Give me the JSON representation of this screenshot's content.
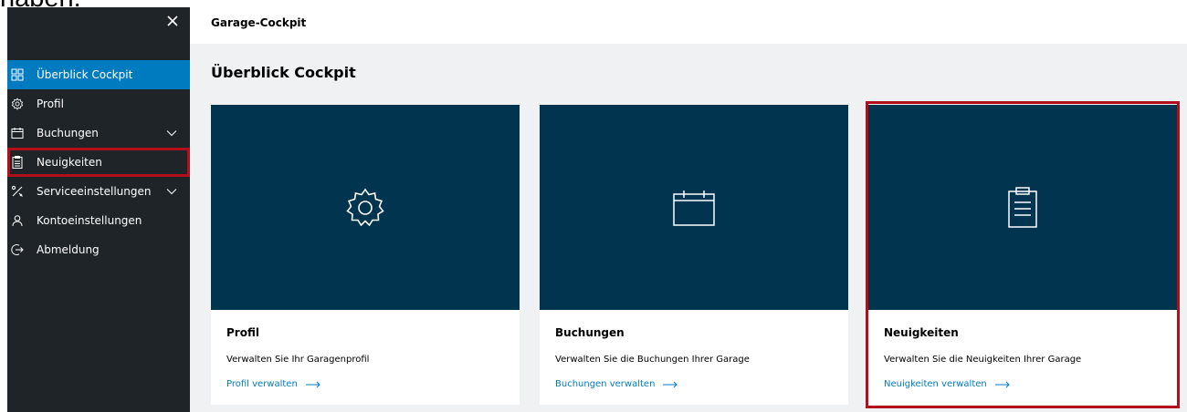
{
  "caption": "haben.",
  "sidebar": {
    "items": [
      {
        "label": "Überblick Cockpit",
        "icon": "grid-icon",
        "active": true
      },
      {
        "label": "Profil",
        "icon": "gear-icon"
      },
      {
        "label": "Buchungen",
        "icon": "calendar-icon",
        "expandable": true
      },
      {
        "label": "Neuigkeiten",
        "icon": "clipboard-icon",
        "highlighted": true
      },
      {
        "label": "Serviceeinstellungen",
        "icon": "tools-icon",
        "expandable": true
      },
      {
        "label": "Kontoeinstellungen",
        "icon": "user-icon"
      },
      {
        "label": "Abmeldung",
        "icon": "logout-icon"
      }
    ]
  },
  "header": {
    "title": "Garage-Cockpit"
  },
  "main": {
    "title": "Überblick Cockpit",
    "cards": [
      {
        "title": "Profil",
        "description": "Verwalten Sie Ihr Garagenprofil",
        "link": "Profil verwalten",
        "icon": "gear-icon"
      },
      {
        "title": "Buchungen",
        "description": "Verwalten Sie die Buchungen Ihrer Garage",
        "link": "Buchungen verwalten",
        "icon": "calendar-icon"
      },
      {
        "title": "Neuigkeiten",
        "description": "Verwalten Sie die Neuigkeiten Ihrer Garage",
        "link": "Neuigkeiten verwalten",
        "icon": "clipboard-icon",
        "highlighted": true
      }
    ]
  },
  "colors": {
    "sidebar_bg": "#1f2429",
    "active_blue": "#007bc0",
    "hero_bg": "#00344f",
    "highlight_red": "#b30f1a",
    "main_bg": "#eff1f2"
  }
}
